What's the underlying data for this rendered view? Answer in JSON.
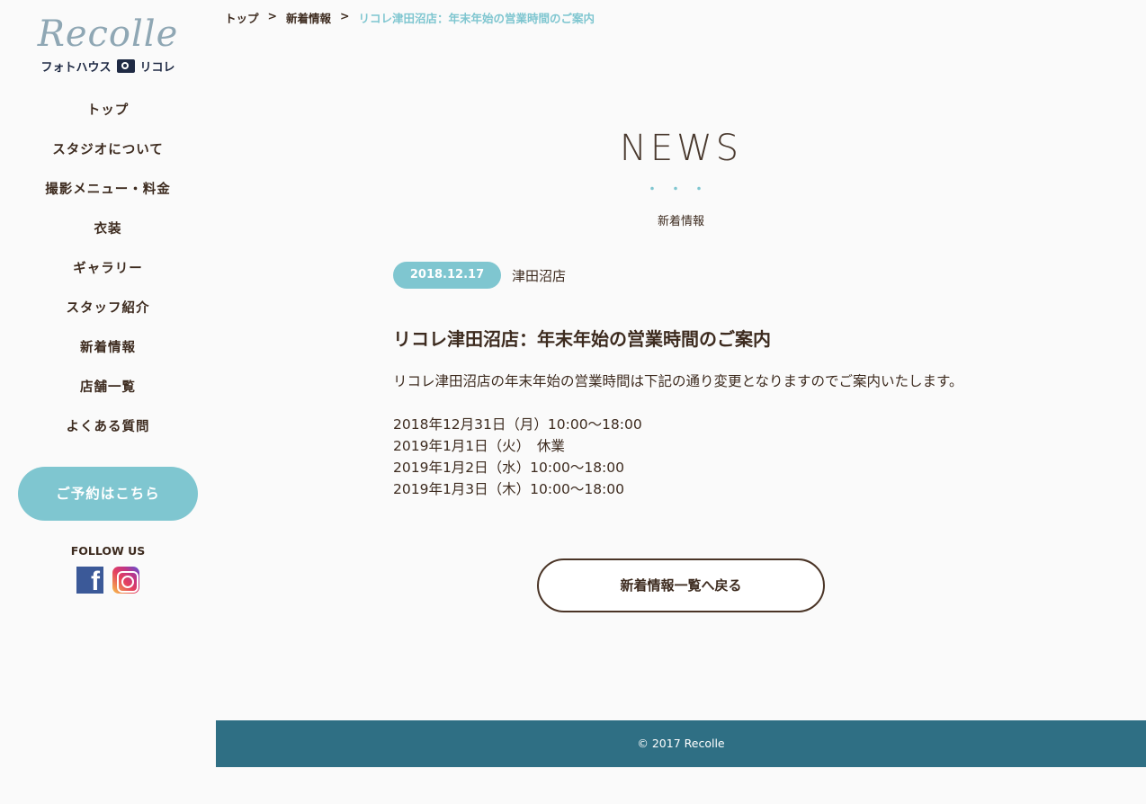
{
  "sidebar": {
    "logo_script": "Recolle",
    "logo_sub_left": "フォトハウス",
    "logo_sub_right": "リコレ",
    "nav": [
      "トップ",
      "スタジオについて",
      "撮影メニュー・料金",
      "衣装",
      "ギャラリー",
      "スタッフ紹介",
      "新着情報",
      "店舗一覧",
      "よくある質問"
    ],
    "reserve_label": "ご予約はこちら",
    "follow_label": "FOLLOW US",
    "fb_glyph": "f"
  },
  "breadcrumb": {
    "home": "トップ",
    "sep": ">",
    "news": "新着情報",
    "current": "リコレ津田沼店：年末年始の営業時間のご案内"
  },
  "page": {
    "title": "NEWS",
    "dots": "・・・",
    "subtitle": "新着情報"
  },
  "article": {
    "date": "2018.12.17",
    "store": "津田沼店",
    "title": "リコレ津田沼店：年末年始の営業時間のご案内",
    "intro": "リコレ津田沼店の年末年始の営業時間は下記の通り変更となりますのでご案内いたします。",
    "hours": [
      "2018年12月31日（月）10:00～18:00",
      "2019年1月1日（火）　休業",
      "2019年1月2日（水）10:00～18:00",
      "2019年1月3日（木）10:00～18:00"
    ]
  },
  "back_label": "新着情報一覧へ戻る",
  "footer": "© 2017 Recolle",
  "colors": {
    "accent": "#7fc6d0",
    "text": "#3d2b1f",
    "footer": "#2f6f84"
  }
}
